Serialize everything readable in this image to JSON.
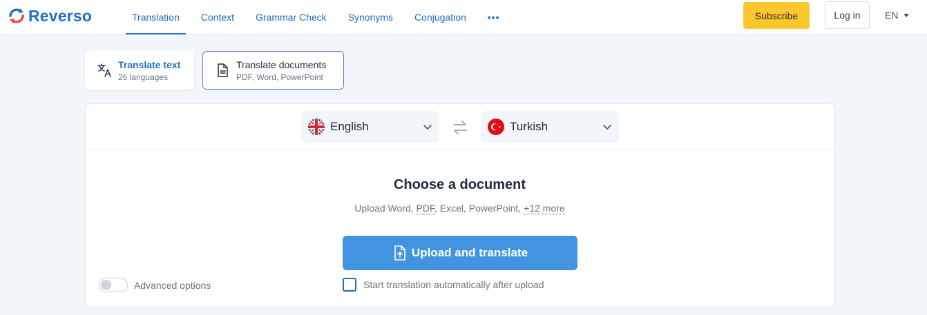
{
  "brand": {
    "name": "Reverso",
    "color": "#1f6fc5"
  },
  "nav": {
    "items": [
      {
        "label": "Translation",
        "active": true
      },
      {
        "label": "Context"
      },
      {
        "label": "Grammar Check"
      },
      {
        "label": "Synonyms"
      },
      {
        "label": "Conjugation"
      }
    ],
    "more": "•••"
  },
  "header": {
    "subscribe_label": "Subscribe",
    "login_label": "Log in",
    "ui_language": "EN"
  },
  "modes": {
    "text": {
      "title": "Translate text",
      "subtitle": "26 languages",
      "icon": "translate-icon"
    },
    "docs": {
      "title": "Translate documents",
      "subtitle": "PDF, Word, PowerPoint",
      "icon": "document-icon",
      "selected": true
    }
  },
  "languages": {
    "source": {
      "name": "English",
      "flag": "uk-flag-icon"
    },
    "target": {
      "name": "Turkish",
      "flag": "turkey-flag-icon"
    }
  },
  "upload": {
    "title": "Choose a document",
    "subtitle_prefix": "Upload Word, ",
    "subtitle_pdf": "PDF",
    "subtitle_middle": ", Excel, PowerPoint, ",
    "subtitle_more": "+12 more",
    "button_label": "Upload and translate",
    "button_color": "#4394e0"
  },
  "options": {
    "advanced_label": "Advanced options",
    "advanced_on": false,
    "auto_start_label": "Start translation automatically after upload",
    "auto_start_checked": false
  },
  "colors": {
    "accent": "#1f6fc5",
    "subscribe": "#fcc72c",
    "background": "#f2f5f9"
  }
}
